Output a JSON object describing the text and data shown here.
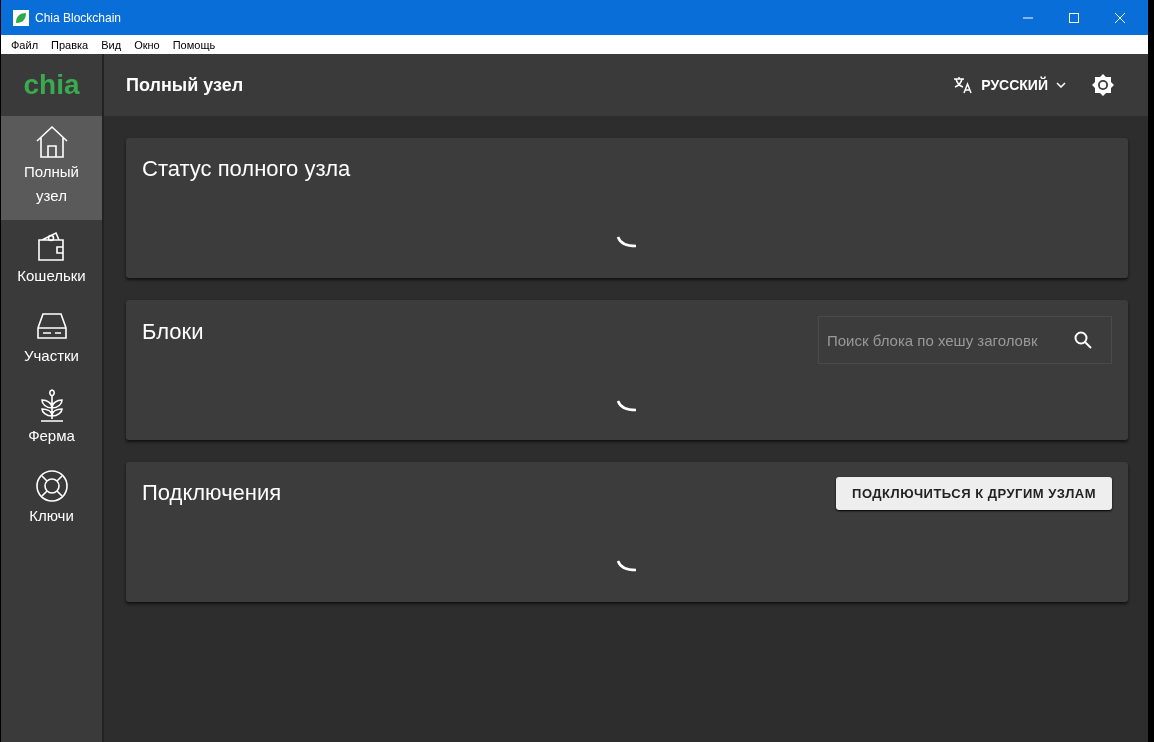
{
  "window": {
    "title": "Chia Blockchain"
  },
  "menu": [
    "Файл",
    "Правка",
    "Вид",
    "Окно",
    "Помощь"
  ],
  "logo": "chia",
  "header": {
    "title": "Полный узел",
    "language": "РУССКИЙ"
  },
  "sidebar": {
    "items": [
      {
        "label": "Полный узел",
        "kind": "home",
        "selected": true
      },
      {
        "label": "Кошельки",
        "kind": "wallet",
        "selected": false
      },
      {
        "label": "Участки",
        "kind": "drive",
        "selected": false
      },
      {
        "label": "Ферма",
        "kind": "plant",
        "selected": false
      },
      {
        "label": "Ключи",
        "kind": "lifebuoy",
        "selected": false
      }
    ]
  },
  "cards": [
    {
      "kind": "status",
      "title": "Статус полного узла",
      "loading": true
    },
    {
      "kind": "search",
      "title": "Блоки",
      "placeholder": "Поиск блока по хешу заголовк",
      "loading": true
    },
    {
      "kind": "action",
      "title": "Подключения",
      "button": "ПОДКЛЮЧИТЬСЯ К ДРУГИМ УЗЛАМ",
      "loading": true
    }
  ]
}
